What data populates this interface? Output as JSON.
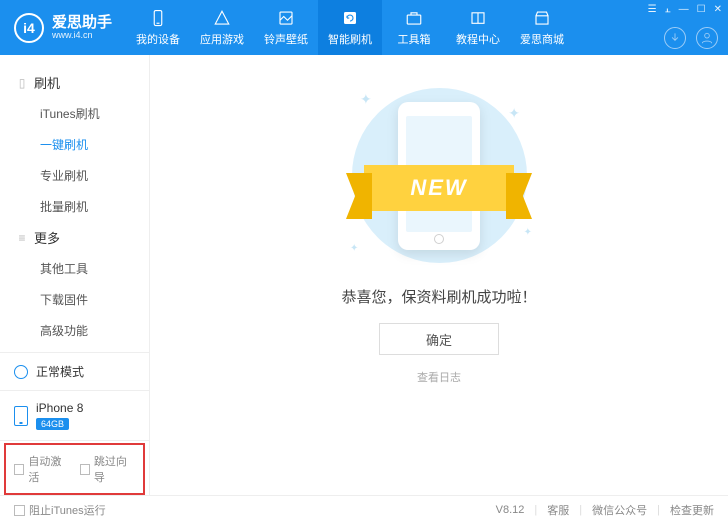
{
  "app": {
    "brand_cn": "爱思助手",
    "brand_url": "www.i4.cn",
    "logo_text": "i4"
  },
  "tabs": [
    {
      "label": "我的设备",
      "icon": "device"
    },
    {
      "label": "应用游戏",
      "icon": "apps"
    },
    {
      "label": "铃声壁纸",
      "icon": "media"
    },
    {
      "label": "智能刷机",
      "icon": "flash",
      "active": true
    },
    {
      "label": "工具箱",
      "icon": "toolbox"
    },
    {
      "label": "教程中心",
      "icon": "book"
    },
    {
      "label": "爱思商城",
      "icon": "store"
    }
  ],
  "sidebar": {
    "group_flash": "刷机",
    "group_more": "更多",
    "items_flash": [
      {
        "label": "iTunes刷机"
      },
      {
        "label": "一键刷机",
        "active": true
      },
      {
        "label": "专业刷机"
      },
      {
        "label": "批量刷机"
      }
    ],
    "items_more": [
      {
        "label": "其他工具"
      },
      {
        "label": "下载固件"
      },
      {
        "label": "高级功能"
      }
    ],
    "mode_label": "正常模式",
    "device_name": "iPhone 8",
    "device_storage": "64GB",
    "chk_auto_activate": "自动激活",
    "chk_skip_guide": "跳过向导"
  },
  "content": {
    "ribbon_text": "NEW",
    "success_message": "恭喜您，保资料刷机成功啦！",
    "confirm_label": "确定",
    "log_link": "查看日志"
  },
  "footer": {
    "block_itunes": "阻止iTunes运行",
    "version": "V8.12",
    "links": [
      "客服",
      "微信公众号",
      "检查更新"
    ]
  }
}
